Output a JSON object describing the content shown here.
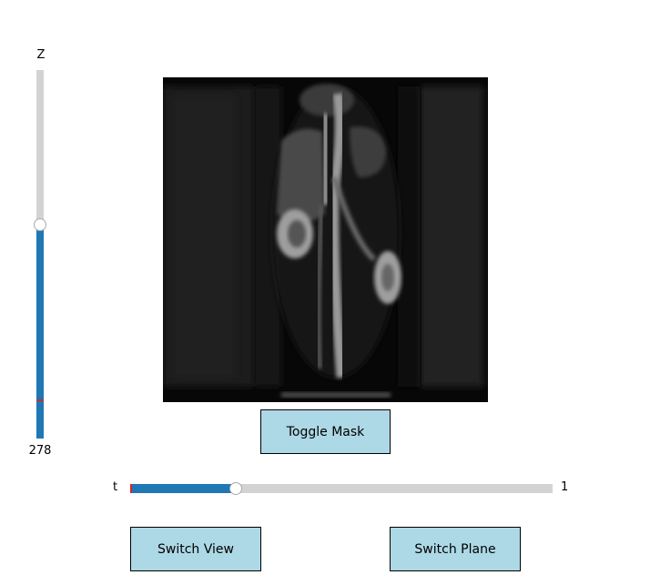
{
  "z_slider": {
    "label": "Z",
    "value": "278",
    "level_fraction": 0.58
  },
  "t_slider": {
    "label": "t",
    "value": "1",
    "level_fraction": 0.25
  },
  "buttons": {
    "toggle_mask": "Toggle Mask",
    "switch_view": "Switch View",
    "switch_plane": "Switch Plane"
  },
  "colors": {
    "slider_fill": "#1f77b4",
    "slider_track": "#d3d3d3",
    "slider_marker": "#d62728",
    "button_bg": "#add8e6",
    "image_bg": "#000000"
  }
}
